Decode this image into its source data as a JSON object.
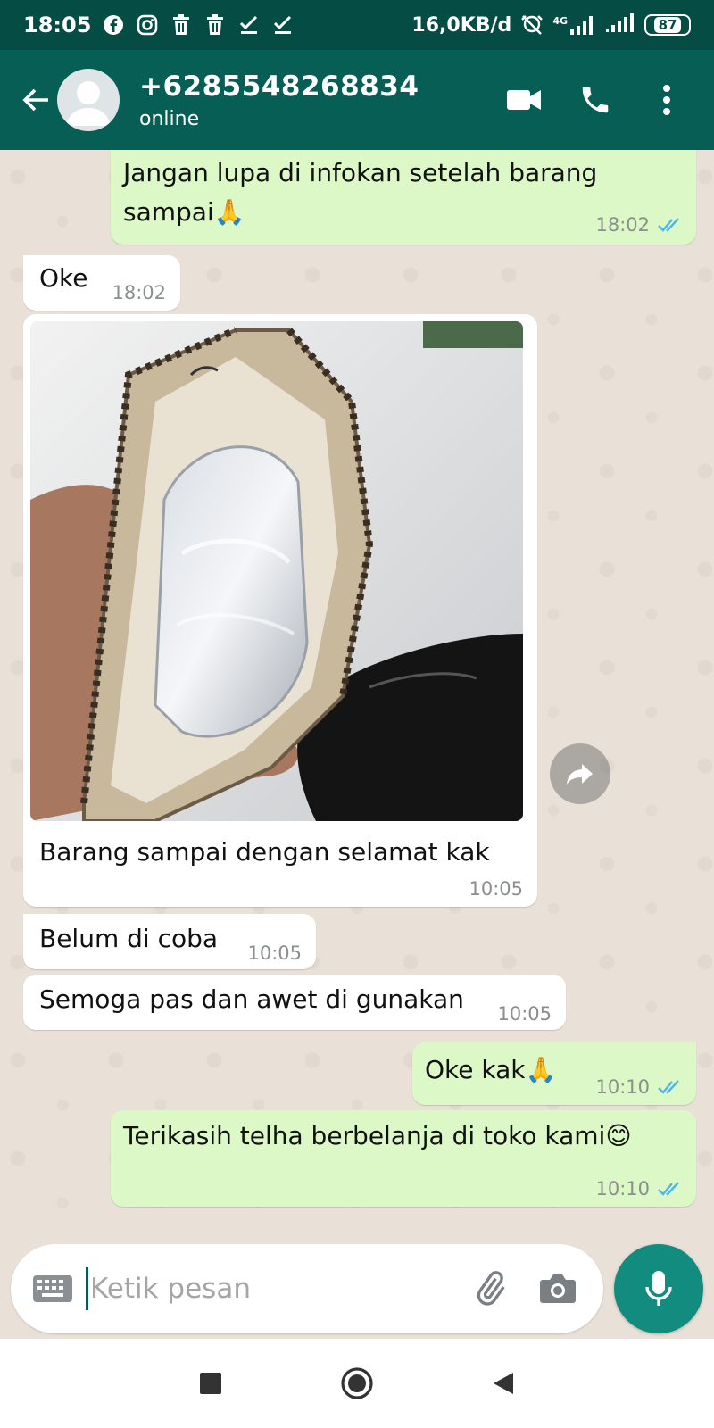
{
  "status_bar": {
    "time": "18:05",
    "network_speed": "16,0KB/d",
    "network_type": "4G",
    "battery": "87",
    "icons": [
      "facebook-icon",
      "instagram-icon",
      "trash-icon",
      "trash-icon",
      "check-icon",
      "check-icon",
      "alarm-off-icon",
      "signal-icon",
      "signal-icon",
      "battery-icon"
    ]
  },
  "header": {
    "contact_name": "+6285548268834",
    "contact_status": "online",
    "icons": [
      "back-arrow-icon",
      "avatar-icon",
      "video-call-icon",
      "phone-icon",
      "more-vert-icon"
    ]
  },
  "messages": [
    {
      "direction": "out",
      "text": "Jangan lupa di infokan setelah barang sampai🙏",
      "time": "18:02",
      "read": true
    },
    {
      "direction": "in",
      "text": "Oke",
      "time": "18:02"
    },
    {
      "direction": "in",
      "type": "image",
      "caption": "Barang sampai dengan selamat kak",
      "time": "10:05"
    },
    {
      "direction": "in",
      "text": "Belum di coba",
      "time": "10:05"
    },
    {
      "direction": "in",
      "text": "Semoga pas dan awet di gunakan",
      "time": "10:05"
    },
    {
      "direction": "out",
      "text": "Oke kak🙏",
      "time": "10:10",
      "read": true
    },
    {
      "direction": "out",
      "text": "Terikasih telha berbelanja di toko kami😊",
      "time": "10:10",
      "read": true
    }
  ],
  "composer": {
    "placeholder": "Ketik pesan",
    "icons": [
      "keyboard-icon",
      "attach-icon",
      "camera-icon",
      "mic-icon"
    ]
  },
  "colors": {
    "status_bar": "#054d44",
    "header": "#075e54",
    "outgoing_bubble": "#dcf8c6",
    "incoming_bubble": "#ffffff",
    "read_tick": "#4fb6ec",
    "mic_button": "#128c7e"
  }
}
